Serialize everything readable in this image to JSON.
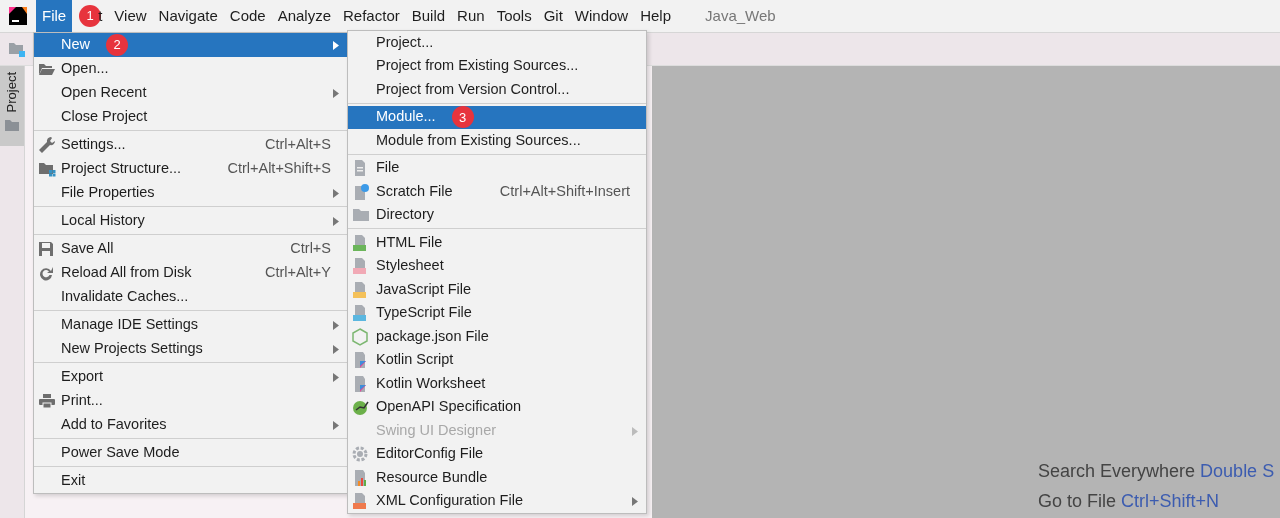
{
  "app": {
    "title": "Java_Web"
  },
  "menubar": [
    {
      "label": "File",
      "selected": true,
      "badge": "1"
    },
    {
      "label": "t",
      "selected": false
    },
    {
      "label": "View",
      "selected": false
    },
    {
      "label": "Navigate",
      "selected": false
    },
    {
      "label": "Code",
      "selected": false
    },
    {
      "label": "Analyze",
      "selected": false
    },
    {
      "label": "Refactor",
      "selected": false
    },
    {
      "label": "Build",
      "selected": false
    },
    {
      "label": "Run",
      "selected": false
    },
    {
      "label": "Tools",
      "selected": false
    },
    {
      "label": "Git",
      "selected": false
    },
    {
      "label": "Window",
      "selected": false
    },
    {
      "label": "Help",
      "selected": false
    }
  ],
  "side_tab": {
    "label": "Project",
    "selected": true
  },
  "file_menu": [
    [
      {
        "label": "New",
        "selected": true,
        "has_submenu": true,
        "badge": "2"
      },
      {
        "label": "Open...",
        "selected": false,
        "has_submenu": false
      },
      {
        "label": "Open Recent",
        "selected": false,
        "has_submenu": true
      },
      {
        "label": "Close Project",
        "selected": false,
        "has_submenu": false
      }
    ],
    [
      {
        "label": "Settings...",
        "shortcut": "Ctrl+Alt+S",
        "selected": false,
        "has_submenu": false
      },
      {
        "label": "Project Structure...",
        "shortcut": "Ctrl+Alt+Shift+S",
        "selected": false,
        "has_submenu": false
      },
      {
        "label": "File Properties",
        "selected": false,
        "has_submenu": true
      }
    ],
    [
      {
        "label": "Local History",
        "selected": false,
        "has_submenu": true
      }
    ],
    [
      {
        "label": "Save All",
        "shortcut": "Ctrl+S",
        "selected": false,
        "has_submenu": false
      },
      {
        "label": "Reload All from Disk",
        "shortcut": "Ctrl+Alt+Y",
        "selected": false,
        "has_submenu": false
      },
      {
        "label": "Invalidate Caches...",
        "selected": false,
        "has_submenu": false
      }
    ],
    [
      {
        "label": "Manage IDE Settings",
        "selected": false,
        "has_submenu": true
      },
      {
        "label": "New Projects Settings",
        "selected": false,
        "has_submenu": true
      }
    ],
    [
      {
        "label": "Export",
        "selected": false,
        "has_submenu": true
      },
      {
        "label": "Print...",
        "selected": false,
        "has_submenu": false
      },
      {
        "label": "Add to Favorites",
        "selected": false,
        "has_submenu": true
      }
    ],
    [
      {
        "label": "Power Save Mode",
        "selected": false,
        "has_submenu": false
      }
    ],
    [
      {
        "label": "Exit",
        "selected": false,
        "has_submenu": false
      }
    ]
  ],
  "new_submenu": [
    [
      {
        "label": "Project...",
        "selected": false,
        "disabled": false,
        "has_submenu": false
      },
      {
        "label": "Project from Existing Sources...",
        "selected": false,
        "disabled": false,
        "has_submenu": false
      },
      {
        "label": "Project from Version Control...",
        "selected": false,
        "disabled": false,
        "has_submenu": false
      }
    ],
    [
      {
        "label": "Module...",
        "selected": true,
        "disabled": false,
        "has_submenu": false,
        "badge": "3"
      },
      {
        "label": "Module from Existing Sources...",
        "selected": false,
        "disabled": false,
        "has_submenu": false
      }
    ],
    [
      {
        "label": "File",
        "selected": false,
        "disabled": false,
        "has_submenu": false
      },
      {
        "label": "Scratch File",
        "shortcut": "Ctrl+Alt+Shift+Insert",
        "selected": false,
        "disabled": false,
        "has_submenu": false
      },
      {
        "label": "Directory",
        "selected": false,
        "disabled": false,
        "has_submenu": false
      }
    ],
    [
      {
        "label": "HTML File",
        "selected": false,
        "disabled": false,
        "has_submenu": false
      },
      {
        "label": "Stylesheet",
        "selected": false,
        "disabled": false,
        "has_submenu": false
      },
      {
        "label": "JavaScript File",
        "selected": false,
        "disabled": false,
        "has_submenu": false
      },
      {
        "label": "TypeScript File",
        "selected": false,
        "disabled": false,
        "has_submenu": false
      },
      {
        "label": "package.json File",
        "selected": false,
        "disabled": false,
        "has_submenu": false
      },
      {
        "label": "Kotlin Script",
        "selected": false,
        "disabled": false,
        "has_submenu": false
      },
      {
        "label": "Kotlin Worksheet",
        "selected": false,
        "disabled": false,
        "has_submenu": false
      },
      {
        "label": "OpenAPI Specification",
        "selected": false,
        "disabled": false,
        "has_submenu": false
      },
      {
        "label": "Swing UI Designer",
        "selected": false,
        "disabled": true,
        "has_submenu": true
      },
      {
        "label": "EditorConfig File",
        "selected": false,
        "disabled": false,
        "has_submenu": false
      },
      {
        "label": "Resource Bundle",
        "selected": false,
        "disabled": false,
        "has_submenu": false
      },
      {
        "label": "XML Configuration File",
        "selected": false,
        "disabled": false,
        "has_submenu": true
      }
    ]
  ],
  "editor_hints": [
    {
      "label": "Search Everywhere",
      "shortcut": "Double S"
    },
    {
      "label": "Go to File",
      "shortcut": "Ctrl+Shift+N"
    }
  ]
}
